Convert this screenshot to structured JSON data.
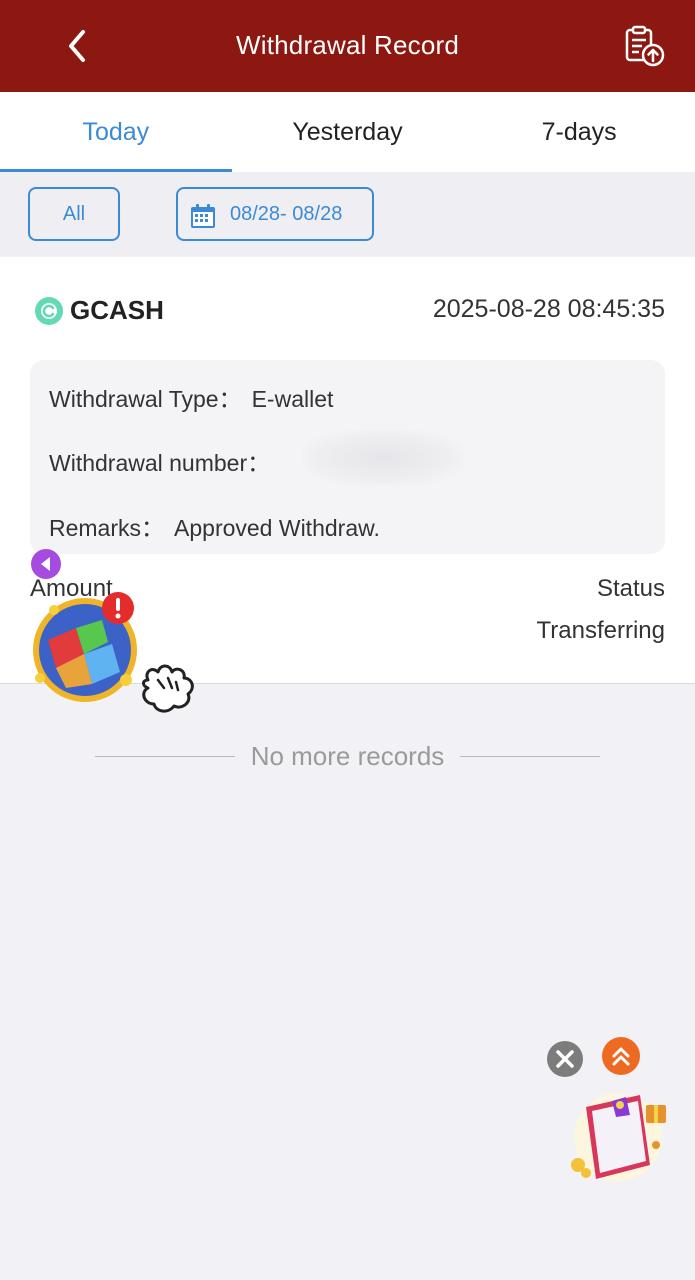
{
  "header": {
    "title": "Withdrawal Record"
  },
  "tabs": [
    {
      "label": "Today",
      "active": true
    },
    {
      "label": "Yesterday",
      "active": false
    },
    {
      "label": "7-days",
      "active": false
    }
  ],
  "filters": {
    "all_label": "All",
    "date_range": "08/28- 08/28"
  },
  "record": {
    "method": "GCASH",
    "timestamp": "2025-08-28 08:45:35",
    "type_label": "Withdrawal Type：",
    "type_value": "E-wallet",
    "number_label": "Withdrawal number：",
    "remarks_label": "Remarks：",
    "remarks_value": "Approved Withdraw.",
    "amount_label": "Amount",
    "status_label": "Status",
    "status_value": "Transferring"
  },
  "footer": {
    "no_more": "No more records"
  },
  "colors": {
    "header_bg": "#8d1811",
    "accent": "#3b8ad6",
    "page_bg": "#f2f2f6"
  }
}
